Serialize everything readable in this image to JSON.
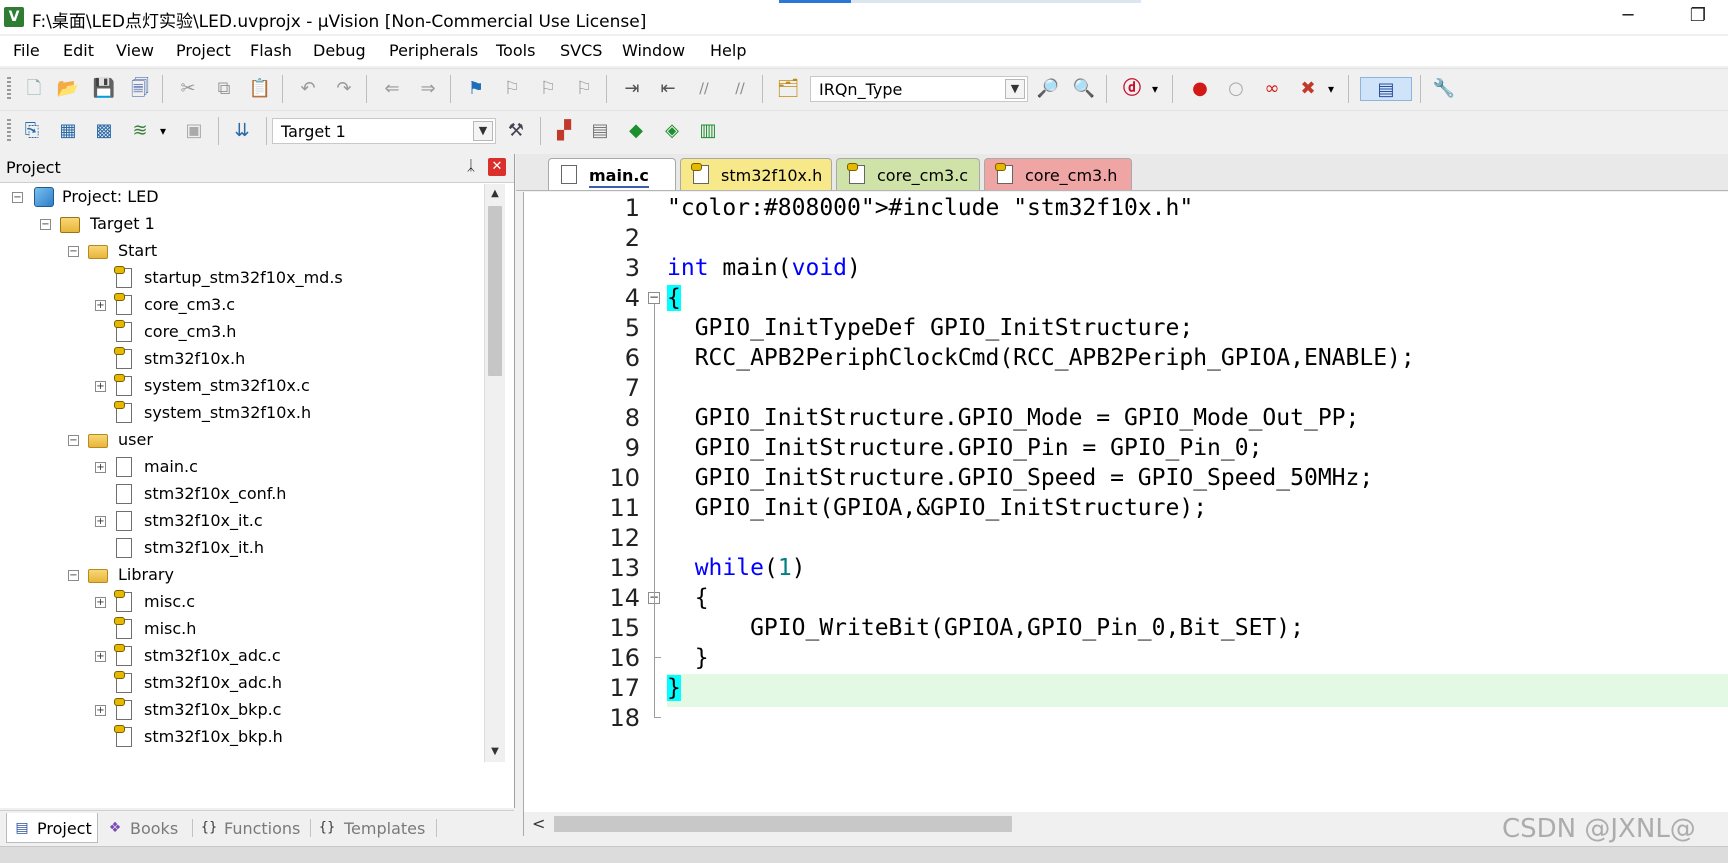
{
  "window": {
    "title": "F:\\桌面\\LED点灯实验\\LED.uvprojx - µVision  [Non-Commercial Use License]",
    "app_icon_glyph": "V",
    "minimize_glyph": "─",
    "restore_glyph": "❐"
  },
  "menu": [
    "File",
    "Edit",
    "View",
    "Project",
    "Flash",
    "Debug",
    "Peripherals",
    "Tools",
    "SVCS",
    "Window",
    "Help"
  ],
  "toolbar1": {
    "icons": [
      "new-file-icon",
      "open-folder-icon",
      "save-icon",
      "save-all-icon",
      "cut-icon",
      "copy-icon",
      "paste-icon",
      "undo-icon",
      "redo-icon",
      "navigate-back-icon",
      "navigate-forward-icon",
      "bookmark-icon",
      "prev-bookmark-icon",
      "next-bookmark-icon",
      "clear-bookmarks-icon",
      "indent-icon",
      "unindent-icon",
      "comment-icon",
      "uncomment-icon",
      "find-in-files-icon",
      "find-icon",
      "incremental-find-icon",
      "debug-session-icon",
      "breakpoint-icon",
      "disable-breakpoint-icon",
      "disable-all-breakpoints-icon",
      "kill-breakpoints-icon",
      "window-layout-icon",
      "configure-icon"
    ],
    "glyphs": {
      "new": "🗋",
      "open": "📂",
      "save": "💾",
      "save_all": "🗐",
      "cut": "✂",
      "copy": "⧉",
      "paste": "📋",
      "undo": "↶",
      "redo": "↷",
      "back": "⇐",
      "forward": "⇒",
      "bookmark": "⚑",
      "prev_bm": "⚐",
      "next_bm": "⚐",
      "clear_bm": "⚐",
      "indent": "⇥",
      "unindent": "⇤",
      "comment": "//",
      "uncomment": "//",
      "find_files": "🗂",
      "find": "🔎",
      "inc_find": "🔍",
      "debug": "ⓓ",
      "breakpoint": "●",
      "bp_disable": "○",
      "bp_all": "∞",
      "bp_kill": "✖",
      "layout": "▤",
      "wrench": "🔧"
    },
    "find_combo": "IRQn_Type",
    "combo_arrow": "▼",
    "dropdown_small": "▾"
  },
  "toolbar2": {
    "target_combo": "Target 1",
    "glyphs": {
      "translate": "⎘",
      "build": "▦",
      "rebuild": "▩",
      "batch": "≋",
      "stop": "▣",
      "load": "⇊",
      "options": "⚒",
      "manage": "▞",
      "pack": "▤",
      "select_pack": "◆",
      "pack_installer": "◈",
      "manage_rte": "▥"
    }
  },
  "project_panel": {
    "title": "Project",
    "pin_glyph": "ᛣ",
    "close_glyph": "✕",
    "tree": [
      {
        "label": "Project: LED",
        "depth": 0,
        "type": "project",
        "expander": "−"
      },
      {
        "label": "Target 1",
        "depth": 1,
        "type": "target",
        "expander": "−"
      },
      {
        "label": "Start",
        "depth": 2,
        "type": "folder",
        "expander": "−"
      },
      {
        "label": "startup_stm32f10x_md.s",
        "depth": 3,
        "type": "file-keyed",
        "expander": ""
      },
      {
        "label": "core_cm3.c",
        "depth": 3,
        "type": "file-keyed",
        "expander": "+"
      },
      {
        "label": "core_cm3.h",
        "depth": 3,
        "type": "file-keyed",
        "expander": ""
      },
      {
        "label": "stm32f10x.h",
        "depth": 3,
        "type": "file-keyed",
        "expander": ""
      },
      {
        "label": "system_stm32f10x.c",
        "depth": 3,
        "type": "file-keyed",
        "expander": "+"
      },
      {
        "label": "system_stm32f10x.h",
        "depth": 3,
        "type": "file-keyed",
        "expander": ""
      },
      {
        "label": "user",
        "depth": 2,
        "type": "folder",
        "expander": "−"
      },
      {
        "label": "main.c",
        "depth": 3,
        "type": "file",
        "expander": "+"
      },
      {
        "label": "stm32f10x_conf.h",
        "depth": 3,
        "type": "file",
        "expander": ""
      },
      {
        "label": "stm32f10x_it.c",
        "depth": 3,
        "type": "file",
        "expander": "+"
      },
      {
        "label": "stm32f10x_it.h",
        "depth": 3,
        "type": "file",
        "expander": ""
      },
      {
        "label": "Library",
        "depth": 2,
        "type": "folder",
        "expander": "−"
      },
      {
        "label": "misc.c",
        "depth": 3,
        "type": "file-keyed",
        "expander": "+"
      },
      {
        "label": "misc.h",
        "depth": 3,
        "type": "file-keyed",
        "expander": ""
      },
      {
        "label": "stm32f10x_adc.c",
        "depth": 3,
        "type": "file-keyed",
        "expander": "+"
      },
      {
        "label": "stm32f10x_adc.h",
        "depth": 3,
        "type": "file-keyed",
        "expander": ""
      },
      {
        "label": "stm32f10x_bkp.c",
        "depth": 3,
        "type": "file-keyed",
        "expander": "+"
      },
      {
        "label": "stm32f10x_bkp.h",
        "depth": 3,
        "type": "file-keyed",
        "expander": ""
      }
    ],
    "scroll_up": "▲",
    "scroll_down": "▼"
  },
  "bottom_tabs": [
    {
      "label": "Project",
      "icon_glyph": "▤",
      "active": true
    },
    {
      "label": "Books",
      "icon_glyph": "❖",
      "active": false
    },
    {
      "label": "Functions",
      "icon_glyph": "{}",
      "active": false
    },
    {
      "label": "Templates",
      "icon_glyph": "{}",
      "active": false
    }
  ],
  "editor_tabs": [
    {
      "label": "main.c",
      "active": true,
      "color": "#ffffff",
      "keyed": false
    },
    {
      "label": "stm32f10x.h",
      "active": false,
      "color": "#f7e98a",
      "keyed": true
    },
    {
      "label": "core_cm3.c",
      "active": false,
      "color": "#cfe3a8",
      "keyed": true
    },
    {
      "label": "core_cm3.h",
      "active": false,
      "color": "#f0a5a5",
      "keyed": true
    }
  ],
  "code": {
    "current_line": 17,
    "lines": [
      "#include \"stm32f10x.h\"",
      "",
      "int main(void)",
      "{",
      "  GPIO_InitTypeDef GPIO_InitStructure;",
      "  RCC_APB2PeriphClockCmd(RCC_APB2Periph_GPIOA,ENABLE);",
      "",
      "  GPIO_InitStructure.GPIO_Mode = GPIO_Mode_Out_PP;",
      "  GPIO_InitStructure.GPIO_Pin = GPIO_Pin_0;",
      "  GPIO_InitStructure.GPIO_Speed = GPIO_Speed_50MHz;",
      "  GPIO_Init(GPIOA,&GPIO_InitStructure);",
      "",
      "  while(1)",
      "  {",
      "      GPIO_WriteBit(GPIOA,GPIO_Pin_0,Bit_SET);",
      "  }",
      "}",
      ""
    ],
    "line_numbers": [
      "1",
      "2",
      "3",
      "4",
      "5",
      "6",
      "7",
      "8",
      "9",
      "10",
      "11",
      "12",
      "13",
      "14",
      "15",
      "16",
      "17",
      "18"
    ],
    "fold_marks": [
      "4",
      "14"
    ],
    "fold_glyph": "−"
  },
  "hscroll_left": "<",
  "watermark": "CSDN @JXNL@",
  "colors": {
    "preprocessor": "#808000",
    "string": "#800080",
    "keyword": "#0000ff",
    "number": "#008080",
    "current_line_bg": "#e3f9e4",
    "brace_match": "#00ffff"
  }
}
